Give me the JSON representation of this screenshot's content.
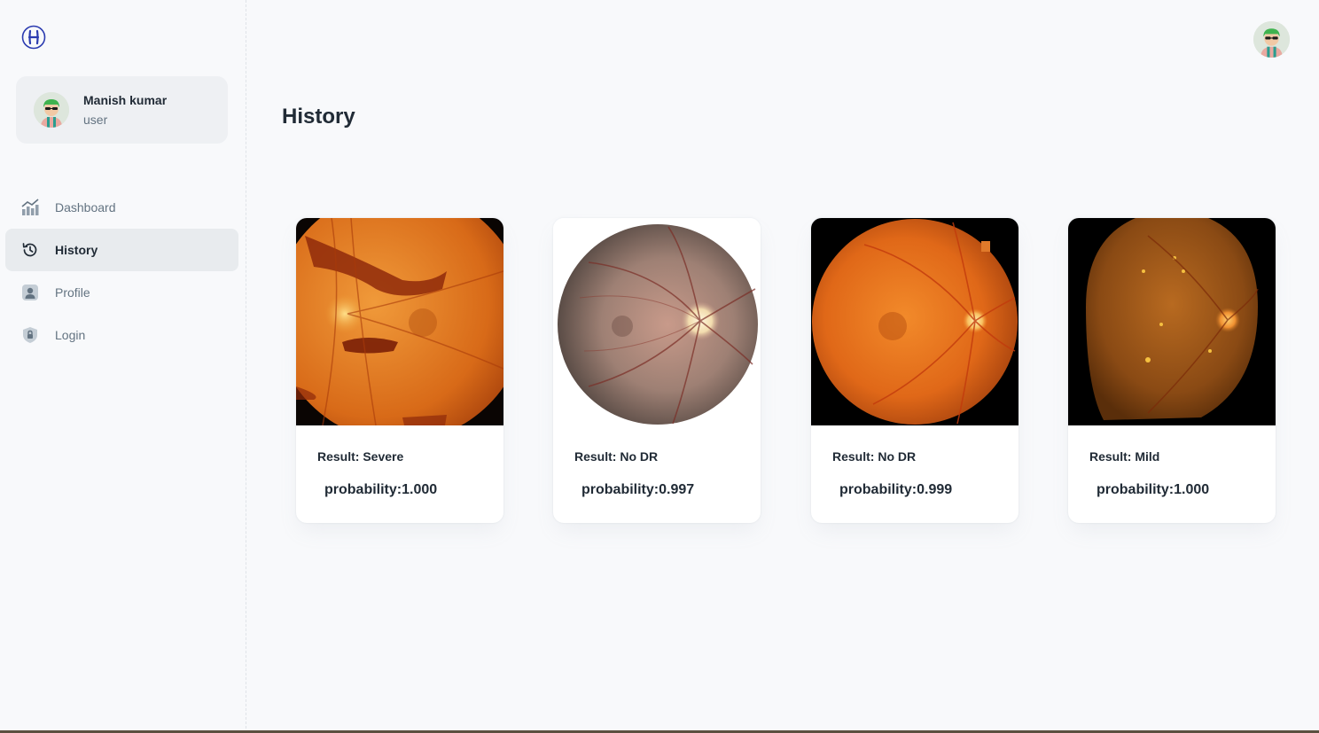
{
  "user": {
    "name": "Manish kumar",
    "role": "user"
  },
  "nav": [
    {
      "label": "Dashboard",
      "icon": "dashboard-icon",
      "active": false
    },
    {
      "label": "History",
      "icon": "history-icon",
      "active": true
    },
    {
      "label": "Profile",
      "icon": "profile-icon",
      "active": false
    },
    {
      "label": "Login",
      "icon": "lock-icon",
      "active": false
    }
  ],
  "page": {
    "title": "History"
  },
  "cards": [
    {
      "result": "Result: Severe",
      "probability": "probability:1.000",
      "image": "retina-fundus-severe"
    },
    {
      "result": "Result: No DR",
      "probability": "probability:0.997",
      "image": "retina-fundus-no-dr"
    },
    {
      "result": "Result: No DR",
      "probability": "probability:0.999",
      "image": "retina-fundus-no-dr"
    },
    {
      "result": "Result: Mild",
      "probability": "probability:1.000",
      "image": "retina-fundus-mild"
    }
  ],
  "colors": {
    "accent": "#2b3bb0",
    "background": "#f8f9fb",
    "active_nav": "#e8ebee"
  }
}
